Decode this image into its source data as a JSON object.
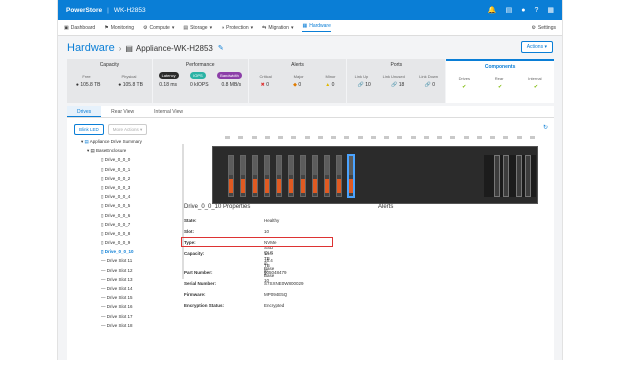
{
  "topbar": {
    "brand": "PowerStore",
    "system": "WK-H2853"
  },
  "nav": {
    "items": [
      "Dashboard",
      "Monitoring",
      "Compute",
      "Storage",
      "Protection",
      "Migration",
      "Hardware"
    ],
    "settings": "Settings"
  },
  "page": {
    "crumb": "Hardware",
    "name": "Appliance-WK-H2853",
    "actions": "Actions"
  },
  "summary": {
    "capacity": {
      "title": "Capacity",
      "free_label": "Free",
      "physical_label": "Physical",
      "free": "105.8 TB",
      "physical": "105.8 TB"
    },
    "performance": {
      "title": "Performance",
      "latency_label": "Latency",
      "iops_label": "IOPS",
      "bandwidth_label": "Bandwidth",
      "latency": "0.18 ms",
      "iops": "0 kIOPS",
      "bandwidth": "0.8 MB/s",
      "colors": {
        "latency": "#2b2b2b",
        "iops": "#2bb3a5",
        "bandwidth": "#8c3fa8"
      }
    },
    "alerts": {
      "title": "Alerts",
      "critical_label": "Critical",
      "major_label": "Major",
      "minor_label": "Minor",
      "critical": "0",
      "major": "0",
      "minor": "0"
    },
    "ports": {
      "title": "Ports",
      "linkup_label": "Link Up",
      "unused_label": "Link Unused",
      "down_label": "Link Down",
      "linkup": "10",
      "unused": "18",
      "down": "0"
    },
    "components": {
      "title": "Components",
      "drives_label": "Drives",
      "rear_label": "Rear",
      "internal_label": "Internal"
    }
  },
  "tabs": [
    "Drives",
    "Rear View",
    "Internal View"
  ],
  "buttons": {
    "blink": "Blink LED",
    "more": "More Actions"
  },
  "tree": {
    "root": "Appliance Drive Summary",
    "enclosure": "BaseEnclosure",
    "items": [
      "Drive_0_0_0",
      "Drive_0_0_1",
      "Drive_0_0_2",
      "Drive_0_0_3",
      "Drive_0_0_4",
      "Drive_0_0_5",
      "Drive_0_0_6",
      "Drive_0_0_7",
      "Drive_0_0_8",
      "Drive_0_0_9",
      "Drive_0_0_10",
      "Drive Slot 11",
      "Drive Slot 12",
      "Drive Slot 13",
      "Drive Slot 14",
      "Drive Slot 15",
      "Drive Slot 16",
      "Drive Slot 17",
      "Drive Slot 18"
    ]
  },
  "props": {
    "title": "Drive_0_0_10 Properties",
    "alerts_title": "Alerts",
    "rows": [
      {
        "label": "State:",
        "value": "Healthy"
      },
      {
        "label": "Slot:",
        "value": "10"
      },
      {
        "label": "Type:",
        "value": "NVMe SSD QLC"
      },
      {
        "label": "Capacity:",
        "value": "14.0 TB in Base 2",
        "value2": "15.4 TB in Base 10"
      },
      {
        "label": "Part Number:",
        "value": "005048479"
      },
      {
        "label": "Serial Number:",
        "value": "S7SXNE0W800029"
      },
      {
        "label": "Firmware:",
        "value": "MP094E5Q"
      },
      {
        "label": "Encryption Status:",
        "value": "Encrypted"
      }
    ]
  }
}
